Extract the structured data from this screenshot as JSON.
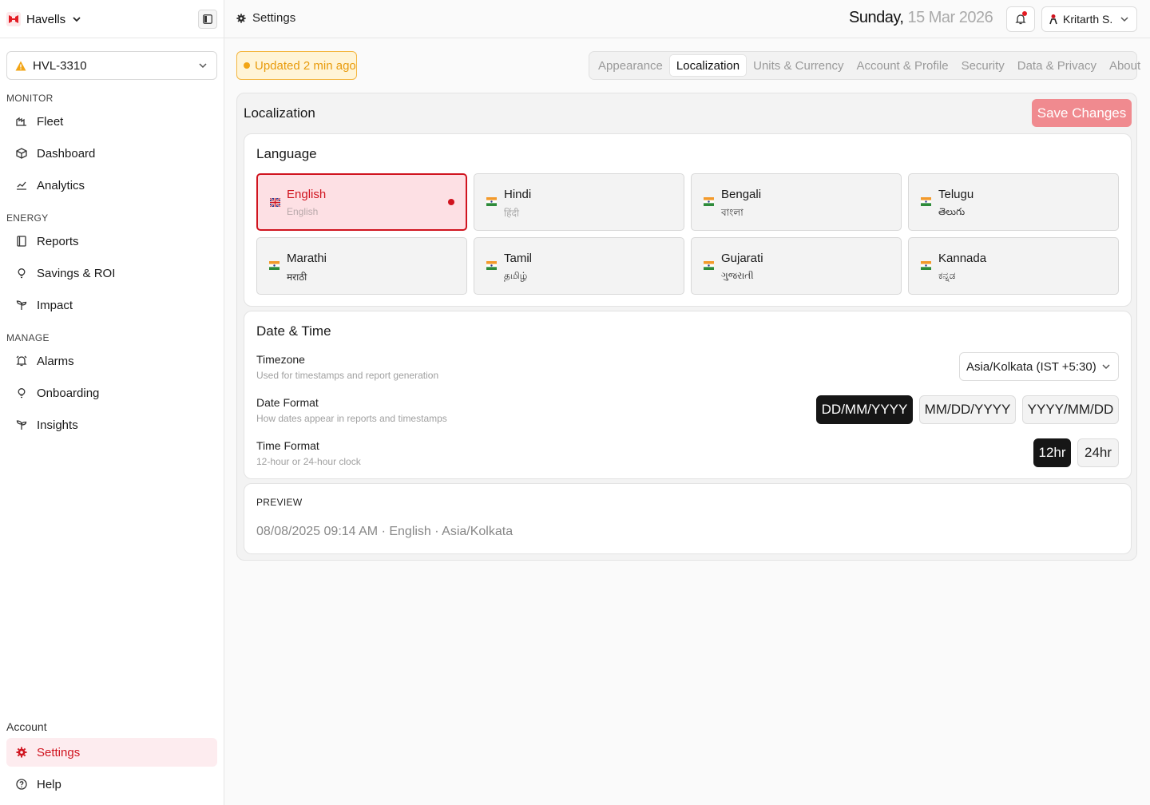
{
  "brand": {
    "name": "Havells"
  },
  "device": {
    "selected": "HVL-3310"
  },
  "sidebar": {
    "sections": [
      {
        "label": "MONITOR",
        "items": [
          "Fleet",
          "Dashboard",
          "Analytics"
        ]
      },
      {
        "label": "ENERGY",
        "items": [
          "Reports",
          "Savings & ROI",
          "Impact"
        ]
      },
      {
        "label": "MANAGE",
        "items": [
          "Alarms",
          "Onboarding",
          "Insights"
        ]
      }
    ],
    "account_label": "Account",
    "settings": "Settings",
    "help": "Help"
  },
  "topbar": {
    "crumb": "Settings",
    "day": "Sunday,",
    "date": "15 Mar 2026",
    "user": "Kritarth S."
  },
  "status": {
    "updated": "Updated 2 min ago"
  },
  "tabs": [
    "Appearance",
    "Localization",
    "Units & Currency",
    "Account & Profile",
    "Security",
    "Data & Privacy",
    "About"
  ],
  "active_tab": "Localization",
  "panel": {
    "title": "Localization",
    "save_label": "Save Changes"
  },
  "language": {
    "title": "Language",
    "selected": "English",
    "options": [
      {
        "name": "English",
        "native": "English"
      },
      {
        "name": "Hindi",
        "native": "हिंदी"
      },
      {
        "name": "Bengali",
        "native": "বাংলা"
      },
      {
        "name": "Telugu",
        "native": "తెలుగు"
      },
      {
        "name": "Marathi",
        "native": "मराठी"
      },
      {
        "name": "Tamil",
        "native": "தமிழ்"
      },
      {
        "name": "Gujarati",
        "native": "ગુજરાતી"
      },
      {
        "name": "Kannada",
        "native": "ಕನ್ನಡ"
      }
    ]
  },
  "datetime": {
    "title": "Date & Time",
    "timezone": {
      "label": "Timezone",
      "sub": "Used for timestamps and report generation",
      "value": "Asia/Kolkata (IST +5:30)"
    },
    "date_format": {
      "label": "Date Format",
      "sub": "How dates appear in reports and timestamps",
      "options": [
        "DD/MM/YYYY",
        "MM/DD/YYYY",
        "YYYY/MM/DD"
      ],
      "selected": "DD/MM/YYYY"
    },
    "time_format": {
      "label": "Time Format",
      "sub": "12-hour or 24-hour clock",
      "options": [
        "12hr",
        "24hr"
      ],
      "selected": "12hr"
    }
  },
  "preview": {
    "label": "PREVIEW",
    "text": "08/08/2025 09:14 AM · English · Asia/Kolkata"
  },
  "colors": {
    "accent": "#d0141f",
    "accent_soft": "#fde0e4",
    "save_button": "#f08a8f",
    "warning": "#f2a516",
    "dark": "#161616"
  }
}
